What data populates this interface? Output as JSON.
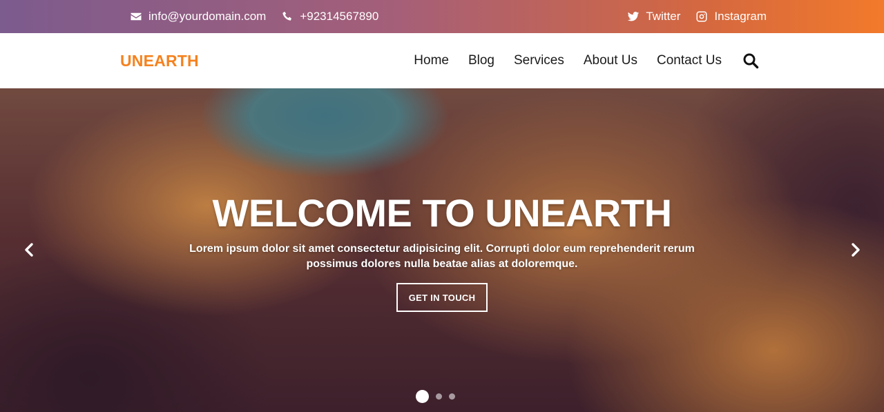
{
  "topbar": {
    "email": "info@yourdomain.com",
    "phone": "+92314567890",
    "email_icon": "envelope-icon",
    "phone_icon": "phone-icon",
    "social": [
      {
        "label": "Twitter",
        "icon": "twitter-icon"
      },
      {
        "label": "Instagram",
        "icon": "instagram-icon"
      }
    ],
    "gradient_colors": [
      "#7c5b8e",
      "#a55f78",
      "#d5683f",
      "#f27a2b"
    ]
  },
  "navbar": {
    "logo": "UNEARTH",
    "logo_color": "#f5821f",
    "menu": [
      "Home",
      "Blog",
      "Services",
      "About Us",
      "Contact Us"
    ],
    "search_icon": "search-icon"
  },
  "hero": {
    "title": "WELCOME TO UNEARTH",
    "text": "Lorem ipsum dolor sit amet consectetur adipisicing elit. Corrupti dolor eum reprehenderit rerum possimus dolores nulla beatae alias at doloremque.",
    "button_label": "GET IN TOUCH",
    "prev_icon": "chevron-left-icon",
    "next_icon": "chevron-right-icon",
    "slides_count": 3,
    "active_slide": 1
  }
}
